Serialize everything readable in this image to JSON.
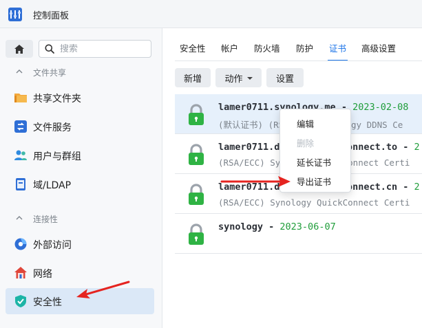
{
  "window": {
    "title": "控制面板"
  },
  "sidebar": {
    "search_placeholder": "搜索",
    "sections": [
      {
        "label": "文件共享",
        "items": [
          "共享文件夹",
          "文件服务",
          "用户与群组",
          "域/LDAP"
        ]
      },
      {
        "label": "连接性",
        "items": [
          "外部访问",
          "网络",
          "安全性"
        ]
      }
    ]
  },
  "tabs": [
    "安全性",
    "帐户",
    "防火墙",
    "防护",
    "证书",
    "高级设置"
  ],
  "active_tab": "证书",
  "toolbar": {
    "add": "新增",
    "action": "动作",
    "settings": "设置"
  },
  "certificates": [
    {
      "name": "lamer0711.synology.me",
      "date": "2023-02-08",
      "desc": "(默认证书) (RSA/ECC) Synology DDNS Ce"
    },
    {
      "name": "lamer0711.direct.quickconnect.to",
      "date": "2",
      "desc": "(RSA/ECC) Synology QuickConnect Certi"
    },
    {
      "name": "lamer0711.direct.quickconnect.cn",
      "date": "2",
      "desc": "(RSA/ECC) Synology QuickConnect Certi"
    },
    {
      "name": "synology",
      "date": "2023-06-07",
      "desc": ""
    }
  ],
  "context_menu": {
    "items": [
      "编辑",
      "删除",
      "延长证书",
      "导出证书"
    ],
    "disabled": [
      "删除"
    ]
  },
  "colors": {
    "accent": "#1a73e8",
    "lock": "#2fb344",
    "date": "#1f9d3a",
    "annotation_arrow": "#e52420"
  }
}
